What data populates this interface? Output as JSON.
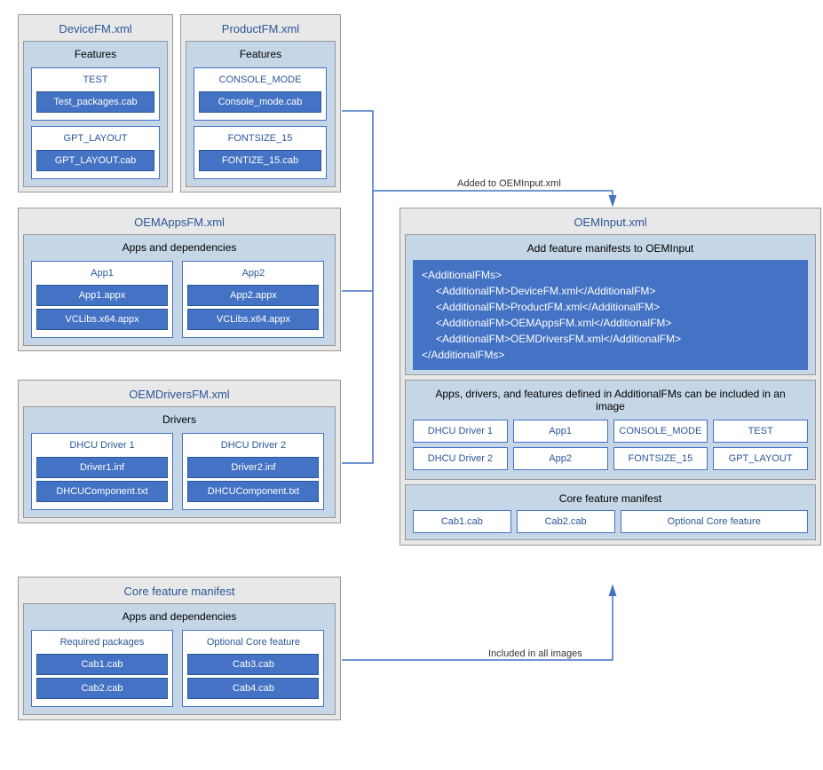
{
  "deviceFM": {
    "title": "DeviceFM.xml",
    "section": "Features",
    "f1": {
      "title": "TEST",
      "pkg": "Test_packages.cab"
    },
    "f2": {
      "title": "GPT_LAYOUT",
      "pkg": "GPT_LAYOUT.cab"
    }
  },
  "productFM": {
    "title": "ProductFM.xml",
    "section": "Features",
    "f1": {
      "title": "CONSOLE_MODE",
      "pkg": "Console_mode.cab"
    },
    "f2": {
      "title": "FONTSIZE_15",
      "pkg": "FONTIZE_15.cab"
    }
  },
  "oemApps": {
    "title": "OEMAppsFM.xml",
    "section": "Apps and dependencies",
    "a1": {
      "title": "App1",
      "p1": "App1.appx",
      "p2": "VCLibs.x64.appx"
    },
    "a2": {
      "title": "App2",
      "p1": "App2.appx",
      "p2": "VCLibs.x64.appx"
    }
  },
  "oemDrivers": {
    "title": "OEMDriversFM.xml",
    "section": "Drivers",
    "d1": {
      "title": "DHCU Driver 1",
      "p1": "Driver1.inf",
      "p2": "DHCUComponent.txt"
    },
    "d2": {
      "title": "DHCU Driver 2",
      "p1": "Driver2.inf",
      "p2": "DHCUComponent.txt"
    }
  },
  "coreFM": {
    "title": "Core feature manifest",
    "section": "Apps and dependencies",
    "c1": {
      "title": "Required packages",
      "p1": "Cab1.cab",
      "p2": "Cab2.cab"
    },
    "c2": {
      "title": "Optional Core feature",
      "p1": "Cab3.cab",
      "p2": "Cab4.cab"
    }
  },
  "oemInput": {
    "title": "OEMInput.xml",
    "sec1": "Add feature manifests to OEMInput",
    "code": {
      "open": "<AdditionalFMs>",
      "l1": "<AdditionalFM>DeviceFM.xml</AdditionalFM>",
      "l2": "<AdditionalFM>ProductFM.xml</AdditionalFM>",
      "l3": "<AdditionalFM>OEMAppsFM.xml</AdditionalFM>",
      "l4": "<AdditionalFM>OEMDriversFM.xml</AdditionalFM>",
      "close": "</AdditionalFMs>"
    },
    "sec2": "Apps, drivers, and features defined in AdditionalFMs can be included in an image",
    "row1": {
      "t1": "DHCU Driver 1",
      "t2": "App1",
      "t3": "CONSOLE_MODE",
      "t4": "TEST"
    },
    "row2": {
      "t1": "DHCU Driver 2",
      "t2": "App2",
      "t3": "FONTSIZE_15",
      "t4": "GPT_LAYOUT"
    },
    "sec3": "Core feature manifest",
    "row3": {
      "t1": "Cab1.cab",
      "t2": "Cab2.cab",
      "t3": "Optional Core feature"
    }
  },
  "labels": {
    "addedTo": "Added to OEMInput.xml",
    "includedAll": "Included in all images"
  }
}
